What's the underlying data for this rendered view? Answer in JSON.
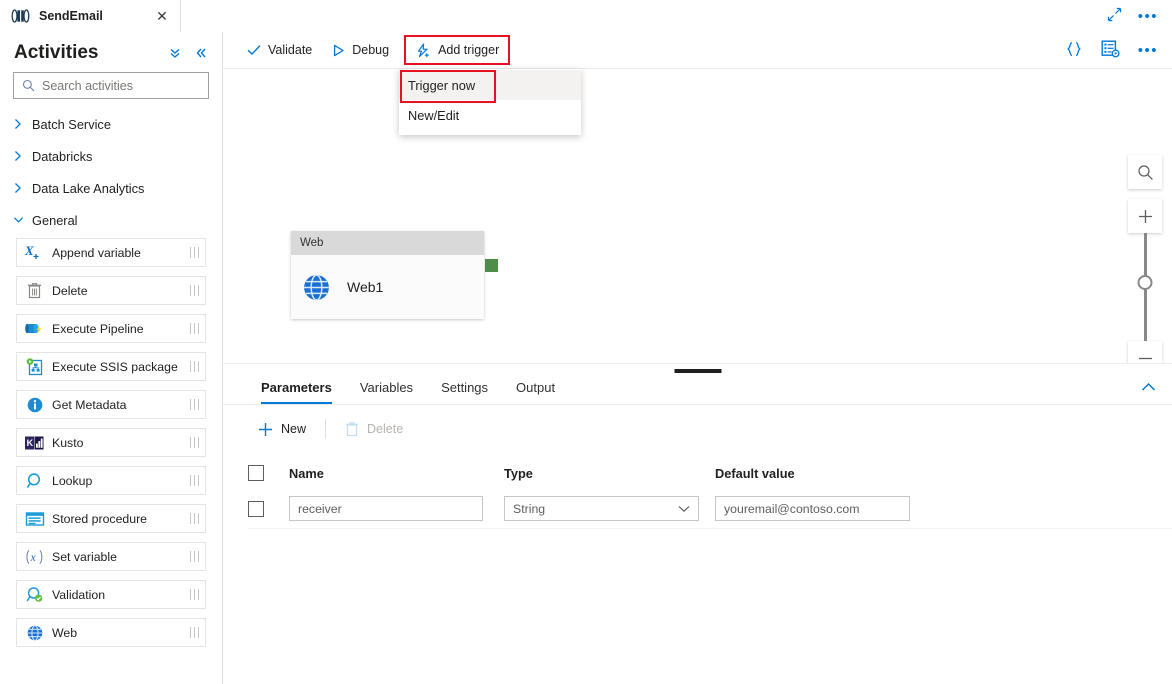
{
  "tab": {
    "icon": "pipeline-icon",
    "title": "SendEmail",
    "close_label": "✕"
  },
  "header_actions": {
    "expand_label": "expand-icon",
    "more_label": "•••"
  },
  "sidebar": {
    "title": "Activities",
    "collapse_all_icon": "chevron-double-down-icon",
    "collapse_panel_icon": "chevron-double-left-icon",
    "search": {
      "placeholder": "Search activities",
      "value": ""
    },
    "categories": [
      {
        "label": "Batch Service",
        "expanded": false
      },
      {
        "label": "Databricks",
        "expanded": false
      },
      {
        "label": "Data Lake Analytics",
        "expanded": false
      },
      {
        "label": "General",
        "expanded": true
      }
    ],
    "activities": [
      {
        "label": "Append variable",
        "icon": "append-variable-icon"
      },
      {
        "label": "Delete",
        "icon": "delete-trash-icon"
      },
      {
        "label": "Execute Pipeline",
        "icon": "execute-pipeline-icon"
      },
      {
        "label": "Execute SSIS package",
        "icon": "execute-ssis-package-icon"
      },
      {
        "label": "Get Metadata",
        "icon": "get-metadata-info-icon"
      },
      {
        "label": "Kusto",
        "icon": "kusto-icon"
      },
      {
        "label": "Lookup",
        "icon": "lookup-magnifier-icon"
      },
      {
        "label": "Stored procedure",
        "icon": "stored-procedure-icon"
      },
      {
        "label": "Set variable",
        "icon": "set-variable-icon"
      },
      {
        "label": "Validation",
        "icon": "validation-icon"
      },
      {
        "label": "Web",
        "icon": "web-globe-icon"
      }
    ]
  },
  "toolbar": {
    "validate_label": "Validate",
    "debug_label": "Debug",
    "add_trigger_label": "Add trigger",
    "code_icon": "code-braces-icon",
    "properties_icon": "properties-gear-icon",
    "more_icon": "•••"
  },
  "dropdown": {
    "items": [
      {
        "label": "Trigger now",
        "highlighted": true,
        "hovered": true
      },
      {
        "label": "New/Edit",
        "highlighted": false,
        "hovered": false
      }
    ]
  },
  "canvas": {
    "node": {
      "type_label": "Web",
      "name": "Web1",
      "icon": "web-globe-icon",
      "port_color": "#4e8c4a"
    },
    "zoom_controls": {
      "search_icon": "magnifier-icon",
      "zoom_in_label": "+",
      "zoom_out_label": "−",
      "fit_icon": "fit-to-screen-icon"
    }
  },
  "bottom_panel": {
    "tabs": [
      {
        "label": "Parameters",
        "active": true
      },
      {
        "label": "Variables",
        "active": false
      },
      {
        "label": "Settings",
        "active": false
      },
      {
        "label": "Output",
        "active": false
      }
    ],
    "collapse_icon": "chevron-up-icon",
    "commands": {
      "new_label": "New",
      "delete_label": "Delete",
      "delete_disabled": true
    },
    "table": {
      "columns": [
        "Name",
        "Type",
        "Default value"
      ],
      "rows": [
        {
          "checked": false,
          "name": "receiver",
          "type": "String",
          "default_value": "youremail@contoso.com"
        }
      ]
    }
  },
  "colors": {
    "accent": "#0078d4",
    "highlight_red": "#e81123",
    "port_green": "#4e8c4a",
    "header_gray": "#d9d9d9"
  }
}
